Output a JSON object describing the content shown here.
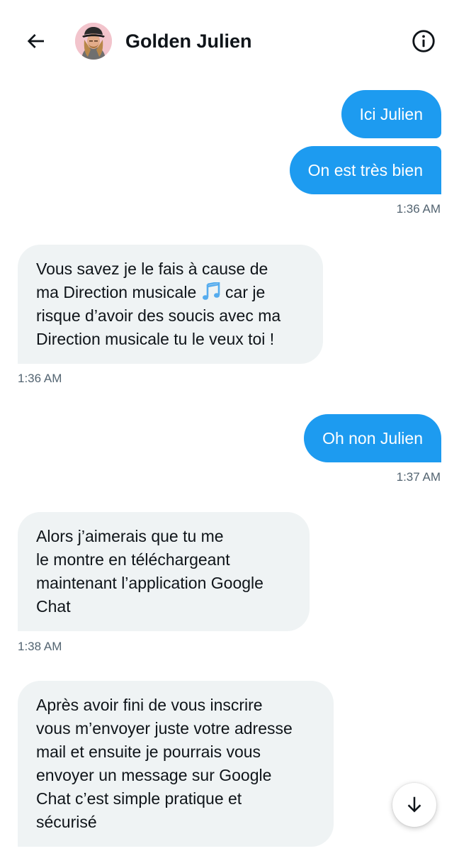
{
  "header": {
    "title": "Golden Julien",
    "back_icon": "arrow-left-icon",
    "info_icon": "info-circle-icon"
  },
  "messages": {
    "m1": {
      "text": "Ici Julien"
    },
    "m2": {
      "text": "On est très bien",
      "time": "1:36 AM"
    },
    "m3": {
      "lines": [
        "Vous savez je le fais à cause de",
        "ma Direction musicale",
        "car je",
        "risque d’avoir des soucis avec ma",
        "Direction musicale tu le veux toi !"
      ],
      "emoji": "musical-notes-icon",
      "time": "1:36 AM"
    },
    "m4": {
      "text": "Oh non Julien",
      "time": "1:37 AM"
    },
    "m5": {
      "lines": [
        "Alors j’aimerais que tu me",
        "le montre en téléchargeant",
        "maintenant l’application Google",
        "Chat"
      ],
      "time": "1:38 AM"
    },
    "m6": {
      "lines": [
        "Après avoir fini de vous inscrire",
        "vous m’envoyer juste votre adresse",
        "mail et ensuite je pourrais vous",
        "envoyer un message sur Google",
        "Chat c’est simple pratique et",
        "sécurisé"
      ]
    }
  },
  "colors": {
    "outgoing_bubble": "#1d9bf0",
    "incoming_bubble": "#eff3f4",
    "timestamp": "#536471"
  },
  "scroll_button_icon": "arrow-down-icon"
}
